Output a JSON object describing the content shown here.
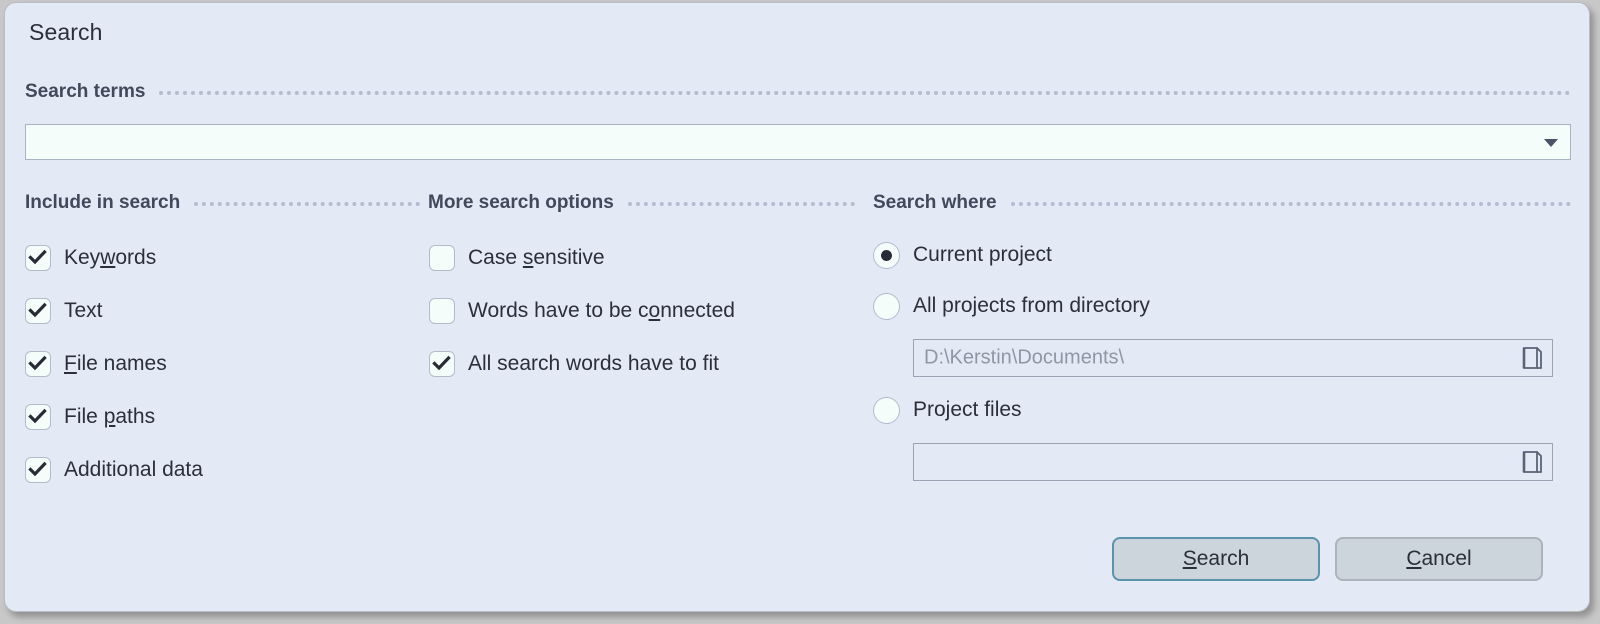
{
  "dialog": {
    "title": "Search"
  },
  "search_terms": {
    "header": "Search terms",
    "value": "",
    "placeholder": "",
    "dropdown_icon": "chevron-down-icon"
  },
  "include_in_search": {
    "header": "Include in search",
    "items": [
      {
        "label_pre": "Key",
        "label_accel": "w",
        "label_post": "ords",
        "checked": true
      },
      {
        "label_pre": "Text",
        "label_accel": "",
        "label_post": "",
        "checked": true
      },
      {
        "label_pre": "",
        "label_accel": "F",
        "label_post": "ile names",
        "checked": true
      },
      {
        "label_pre": "File ",
        "label_accel": "p",
        "label_post": "aths",
        "checked": true
      },
      {
        "label_pre": "Additional data",
        "label_accel": "",
        "label_post": "",
        "checked": true
      }
    ]
  },
  "more_search_options": {
    "header": "More search options",
    "items": [
      {
        "label_pre": "Case ",
        "label_accel": "s",
        "label_post": "ensitive",
        "checked": false
      },
      {
        "label_pre": "Words have to be c",
        "label_accel": "o",
        "label_post": "nnected",
        "checked": false
      },
      {
        "label_pre": "All search words have to fit",
        "label_accel": "",
        "label_post": "",
        "checked": true
      }
    ]
  },
  "search_where": {
    "header": "Search where",
    "options": [
      {
        "label": "Current project",
        "selected": true
      },
      {
        "label": "All projects from directory",
        "selected": false
      },
      {
        "label": "Project files",
        "selected": false
      }
    ],
    "directory_field": {
      "value": "D:\\Kerstin\\Documents\\",
      "browse_icon": "folder-open-icon",
      "disabled": true
    },
    "project_files_field": {
      "value": "",
      "browse_icon": "folder-open-icon",
      "disabled": true
    }
  },
  "buttons": {
    "search": {
      "pre": "",
      "accel": "S",
      "post": "earch",
      "is_default": true
    },
    "cancel": {
      "pre": "",
      "accel": "C",
      "post": "ancel",
      "is_default": false
    }
  },
  "colors": {
    "dialog_bg": "#e3eaf6",
    "input_bg": "#f5fdfb",
    "text": "#2a2f3a",
    "section_text": "#41495a",
    "rule": "#b4bdcd",
    "default_button_border": "#5b93ad",
    "button_bg": "#ccd4dc",
    "disabled_text": "#8f97a5"
  }
}
